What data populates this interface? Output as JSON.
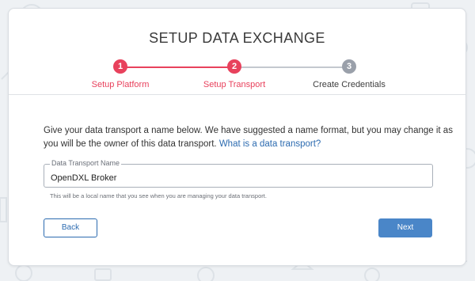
{
  "wizard": {
    "title": "SETUP DATA EXCHANGE",
    "steps": [
      {
        "number": "1",
        "label": "Setup Platform",
        "state": "completed"
      },
      {
        "number": "2",
        "label": "Setup Transport",
        "state": "active"
      },
      {
        "number": "3",
        "label": "Create Credentials",
        "state": "pending"
      }
    ]
  },
  "content": {
    "description": "Give your data transport a name below. We have suggested a name format, but you may change it as you will be the owner of this data transport.",
    "help_link": "What is a data transport?",
    "field": {
      "label": "Data Transport Name",
      "value": "OpenDXL Broker"
    },
    "hint": "This will be a local name that you see when you are managing your data transport."
  },
  "actions": {
    "back_label": "Back",
    "next_label": "Next"
  },
  "colors": {
    "accent": "#e8415c",
    "pending": "#9aa0aa",
    "primary": "#4a86c8",
    "link": "#2c6bb0"
  }
}
